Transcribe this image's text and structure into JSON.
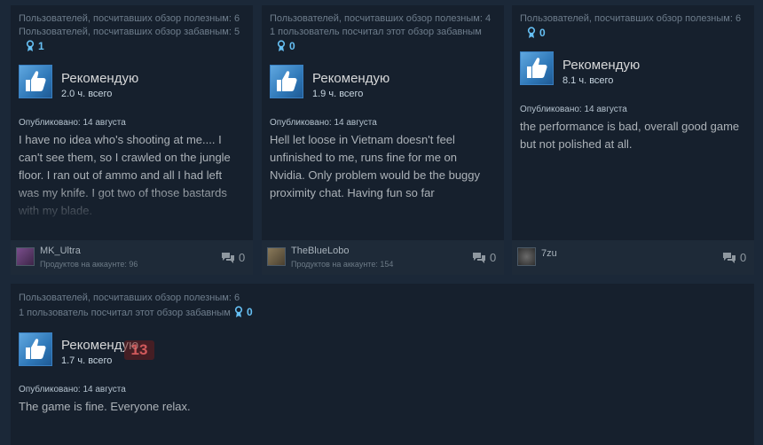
{
  "reviews": [
    {
      "helpful": "Пользователей, посчитавших обзор полезным: 6",
      "funny": "Пользователей, посчитавших обзор забавным: 5",
      "awards": "1",
      "recommend": "Рекомендую",
      "hours": "2.0 ч. всего",
      "posted": "Опубликовано: 14 августа",
      "text": "I have no idea who's shooting at me.... I can't see them, so I crawled on the jungle floor. I ran out of ammo and all I had left was my knife. I got two of those bastards with my blade.",
      "author": "MK_Ultra",
      "products": "Продуктов на аккаунте: 96",
      "comments": "0"
    },
    {
      "helpful": "Пользователей, посчитавших обзор полезным: 4",
      "funny": "1 пользователь посчитал этот обзор забавным",
      "awards": "0",
      "recommend": "Рекомендую",
      "hours": "1.9 ч. всего",
      "posted": "Опубликовано: 14 августа",
      "text": "Hell let loose in Vietnam doesn't feel unfinished to me, runs fine for me on Nvidia. Only problem would be the buggy proximity chat. Having fun so far",
      "author": "TheBlueLobo",
      "products": "Продуктов на аккаунте: 154",
      "comments": "0"
    },
    {
      "helpful": "Пользователей, посчитавших обзор полезным: 6",
      "funny": "",
      "awards": "0",
      "recommend": "Рекомендую",
      "hours": "8.1 ч. всего",
      "posted": "Опубликовано: 14 августа",
      "text": "the performance is bad, overall good game but not polished at all.",
      "author": "7zu",
      "products": "",
      "comments": "0"
    },
    {
      "helpful": "Пользователей, посчитавших обзор полезным: 6",
      "funny": "1 пользователь посчитал этот обзор забавным",
      "awards": "0",
      "recommend": "Рекомендую",
      "hours": "1.7 ч. всего",
      "posted": "Опубликовано: 14 августа",
      "text": "The game is fine. Everyone relax."
    }
  ],
  "watermark": "13",
  "colors": {
    "background": "#1b2838",
    "card": "#16202d",
    "accent": "#66c0f4",
    "thumb": "#3a80c2"
  },
  "icons": {
    "award": "award-ribbon-icon",
    "recommend": "thumbs-up-icon",
    "comments": "comment-bubble-icon"
  }
}
